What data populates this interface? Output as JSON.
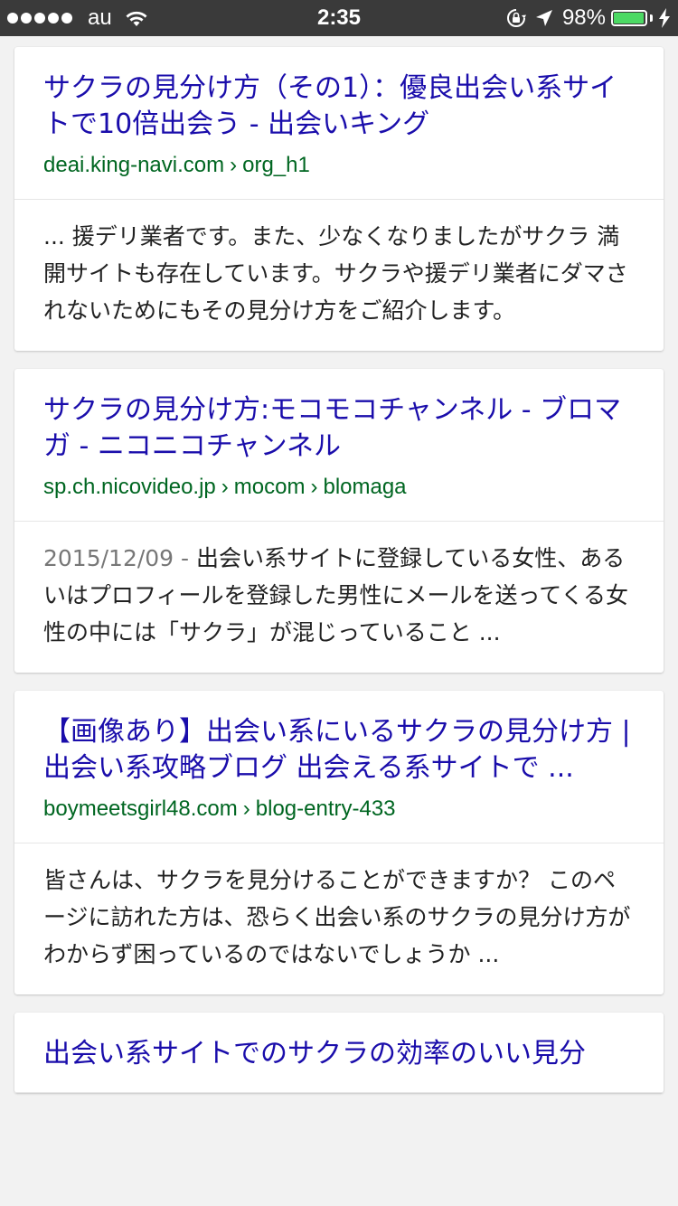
{
  "status_bar": {
    "carrier": "au",
    "time": "2:35",
    "battery_percent": "98%",
    "battery_level": 0.98,
    "signal_bars": 5,
    "icons": [
      "signal-dots-icon",
      "wifi-icon",
      "orientation-lock-icon",
      "location-arrow-icon",
      "battery-icon",
      "charging-bolt-icon"
    ],
    "colors": {
      "bar": "#3a3a3a",
      "battery": "#4cd964"
    }
  },
  "results": [
    {
      "title": "サクラの見分け方（その1）：優良出会い系サイトで10倍出会う - 出会いキング",
      "url_parts": [
        "deai.king-navi.com",
        "org_h1"
      ],
      "url_separator": "›",
      "date": "",
      "snippet": "... 援デリ業者です。また、少なくなりましたがサクラ 満開サイトも存在しています。サクラや援デリ業者にダマされないためにもその見分け方をご紹介します。"
    },
    {
      "title": "サクラの見分け方:モコモコチャンネル - ブロマガ - ニコニコチャンネル",
      "url_parts": [
        "sp.ch.nicovideo.jp",
        "mocom",
        "blomaga"
      ],
      "url_separator": "›",
      "date": "2015/12/09 - ",
      "snippet": "出会い系サイトに登録している女性、あるいはプロフィールを登録した男性にメールを送ってくる女性の中には「サクラ」が混じっていること ..."
    },
    {
      "title": "【画像あり】出会い系にいるサクラの見分け方 | 出会い系攻略ブログ 出会える系サイトで ...",
      "url_parts": [
        "boymeetsgirl48.com",
        "blog-entry-433"
      ],
      "url_separator": "›",
      "date": "",
      "snippet": "皆さんは、サクラを見分けることができますか？ このページに訪れた方は、恐らく出会い系のサクラの見分け方がわからず困っているのではないでしょうか ..."
    },
    {
      "title": "出会い系サイトでのサクラの効率のいい見分",
      "url_parts": [],
      "url_separator": "›",
      "date": "",
      "snippet": ""
    }
  ],
  "colors": {
    "title_link": "#1a0dab",
    "url": "#006621",
    "date": "#777777",
    "snippet": "#222222",
    "page_bg": "#f2f2f2"
  }
}
